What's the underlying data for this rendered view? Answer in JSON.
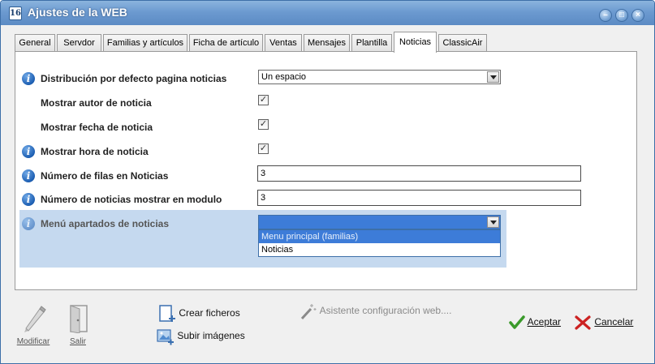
{
  "window": {
    "title": "Ajustes de la WEB",
    "app_icon_text": "16"
  },
  "tabs": [
    {
      "label": "General"
    },
    {
      "label": "Servdor"
    },
    {
      "label": "Familias y artículos"
    },
    {
      "label": "Ficha de artículo"
    },
    {
      "label": "Ventas"
    },
    {
      "label": "Mensajes"
    },
    {
      "label": "Plantilla"
    },
    {
      "label": "Noticias",
      "active": true
    },
    {
      "label": "ClassicAir"
    }
  ],
  "settings": {
    "distribucion": {
      "label": "Distribución por defecto pagina noticias",
      "value": "Un espacio"
    },
    "mostrar_autor": {
      "label": "Mostrar autor de noticia",
      "checked": true
    },
    "mostrar_fecha": {
      "label": "Mostrar fecha de noticia",
      "checked": true
    },
    "mostrar_hora": {
      "label": "Mostrar hora de noticia",
      "checked": true
    },
    "numero_filas": {
      "label": "Número de filas en Noticias",
      "value": "3"
    },
    "numero_modulo": {
      "label": "Número de noticias mostrar en modulo",
      "value": "3"
    },
    "menu_apartados": {
      "label": "Menú apartados de noticias",
      "value": "",
      "options": [
        "Menu principal (familias)",
        "Noticias"
      ]
    }
  },
  "toolbar": {
    "modificar": "Modificar",
    "salir": "Salir",
    "crear_ficheros": "Crear ficheros",
    "subir_imagenes": "Subir imágenes",
    "asistente": "Asistente configuración web....",
    "aceptar": "Aceptar",
    "cancelar": "Cancelar"
  },
  "colors": {
    "titlebar": "#6c9ad0",
    "selection_band": "#c5d9ef",
    "dropdown_highlight": "#3d7cd8",
    "accept_green": "#3a9a2a",
    "cancel_red": "#cc2222"
  },
  "icons": [
    "info-icon",
    "pencil-icon",
    "door-icon",
    "new-file-icon",
    "image-upload-icon",
    "magic-wand-icon",
    "checkmark-icon",
    "x-mark-icon"
  ]
}
